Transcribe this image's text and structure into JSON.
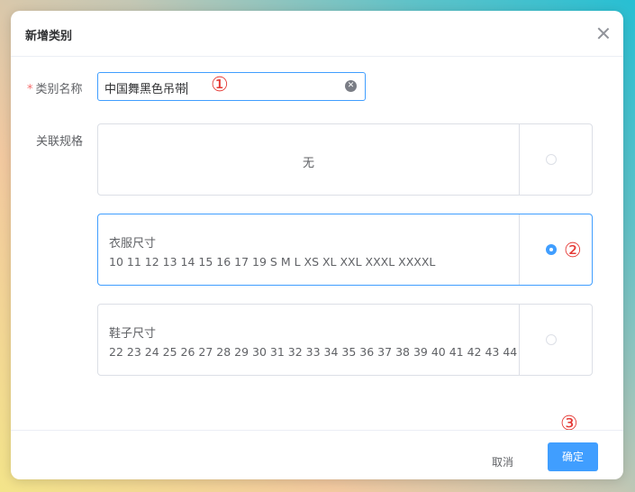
{
  "dialog": {
    "title": "新增类别",
    "close_icon": "close-icon"
  },
  "form": {
    "name_label": "类别名称",
    "required_mark": "*",
    "name_value": "中国舞黑色吊带",
    "spec_label": "关联规格"
  },
  "markers": [
    "①",
    "②",
    "③"
  ],
  "specs": [
    {
      "name": "",
      "values": "",
      "center_text": "无",
      "selected": false
    },
    {
      "name": "衣服尺寸",
      "values": "10 11 12 13 14 15 16 17 19 S M L XS XL XXL XXXL XXXXL",
      "selected": true
    },
    {
      "name": "鞋子尺寸",
      "values": "22 23 24 25 26 27 28 29 30 31 32 33 34 35 36 37 38 39 40 41 42 43 44",
      "selected": false
    }
  ],
  "footer": {
    "cancel_label": "取消",
    "confirm_label": "确定"
  },
  "colors": {
    "primary": "#409eff",
    "marker": "#e53935",
    "required": "#f56c6c"
  }
}
